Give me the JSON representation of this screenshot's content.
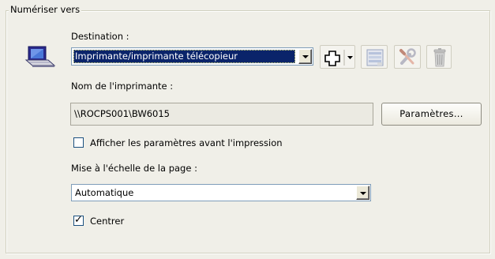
{
  "group": {
    "title": "Numériser vers"
  },
  "destination": {
    "label": "Destination :",
    "selected": "Imprimante/imprimante télécopieur",
    "icon": "scanner-icon"
  },
  "toolbar": {
    "add_icon": "add-destination-icon",
    "properties_icon": "properties-icon",
    "tools_icon": "tools-icon",
    "delete_icon": "trash-icon"
  },
  "printer": {
    "label": "Nom de l'imprimante :",
    "value": "\\\\ROCPS001\\BW6015",
    "settings_button": "Paramètres..."
  },
  "show_settings": {
    "label": "Afficher les paramètres avant l'impression",
    "checked": false
  },
  "scaling": {
    "label": "Mise à l'échelle de la page :",
    "selected": "Automatique"
  },
  "center": {
    "label": "Centrer",
    "checked": true
  },
  "colors": {
    "background": "#f0efe8",
    "selection": "#0a246a",
    "field_border": "#7f9db9"
  }
}
